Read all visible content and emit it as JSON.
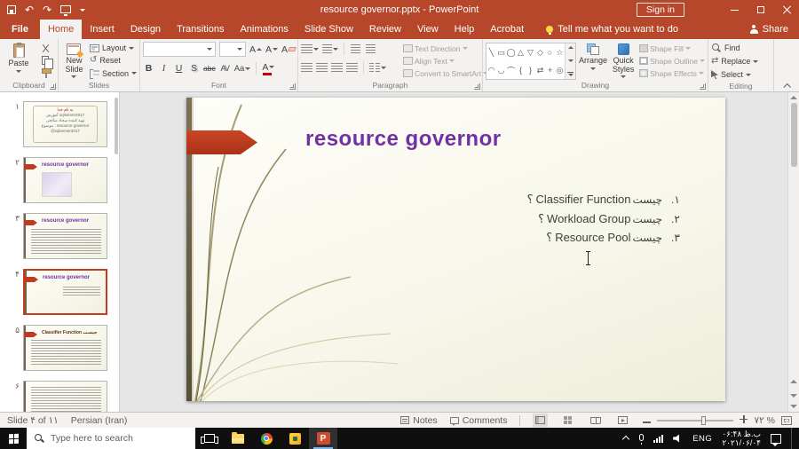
{
  "colors": {
    "titlebar": "#b7472a",
    "slide_title": "#7030a0",
    "arrow_red": "#bf3a21"
  },
  "icons": {
    "undo": "↶",
    "redo": "↷",
    "reset": "↺",
    "swap": "⇄"
  },
  "titlebar": {
    "title": "resource governor.pptx - PowerPoint",
    "sign_in_label": "Sign in"
  },
  "tabs": [
    "File",
    "Home",
    "Insert",
    "Design",
    "Transitions",
    "Animations",
    "Slide Show",
    "Review",
    "View",
    "Help",
    "Acrobat"
  ],
  "tab_row": {
    "tell_me": "Tell me what you want to do",
    "share": "Share"
  },
  "ribbon": {
    "clipboard": {
      "group": "Clipboard",
      "paste": "Paste"
    },
    "slides": {
      "group": "Slides",
      "new_slide": "New Slide",
      "layout": "Layout",
      "reset": "Reset",
      "section": "Section"
    },
    "font": {
      "group": "Font",
      "a": "A",
      "bold": "B",
      "italic": "I",
      "underline": "U",
      "shadow": "S",
      "strike": "abc",
      "spacing": "AV",
      "case": "Aa",
      "color": "A"
    },
    "paragraph": {
      "group": "Paragraph",
      "text_direction": "Text Direction",
      "align_text": "Align Text",
      "smartart": "Convert to SmartArt"
    },
    "drawing": {
      "group": "Drawing",
      "arrange": "Arrange",
      "quick_styles": "Quick Styles",
      "shape_fill": "Shape Fill",
      "shape_outline": "Shape Outline",
      "shape_effects": "Shape Effects",
      "shapes_row1": [
        "╲",
        "▭",
        "◯",
        "△",
        "▽",
        "◇",
        "○",
        "☆"
      ],
      "shapes_row2": [
        "◠",
        "◡",
        "⌒",
        "{",
        "}",
        "⇄",
        "+",
        "◎"
      ]
    },
    "editing": {
      "group": "Editing",
      "find": "Find",
      "replace": "Replace",
      "select": "Select"
    }
  },
  "slide": {
    "title": "resource governor",
    "items": [
      {
        "q": "؟",
        "term": "Classifier Function",
        "fa": "چیست",
        "num": ".۱"
      },
      {
        "q": "؟",
        "term": "Workload Group",
        "fa": "چیست",
        "num": ".۲"
      },
      {
        "q": "؟",
        "term": "Resource Pool",
        "fa": "چیست",
        "num": ".۳"
      }
    ]
  },
  "thumbnails": [
    {
      "num": "۱",
      "line1": "به نام خدا",
      "line2": "آموزش sqlserver2017",
      "line3": "تهیه کننده سجاد صالحی",
      "line4": "موضوع : resource governor",
      "line5": "@sqlserver2017"
    },
    {
      "num": "۲",
      "title": "resource governor"
    },
    {
      "num": "۳",
      "title": "resource governor"
    },
    {
      "num": "۴",
      "title": "resource governor"
    },
    {
      "num": "۵",
      "title": "Classifier Function چیست"
    },
    {
      "num": "۶"
    }
  ],
  "statusbar": {
    "slide_of": "Slide ۴ of ۱۱",
    "language": "Persian (Iran)",
    "notes": "Notes",
    "comments": "Comments",
    "zoom": "۷۲ %"
  },
  "taskbar": {
    "search_placeholder": "Type here to search",
    "lang": "ENG",
    "time": "۰۶:۴۸ ب.ظ",
    "date": "۲۰۲۱/۰۶/۰۴",
    "ppt_letter": "P"
  }
}
